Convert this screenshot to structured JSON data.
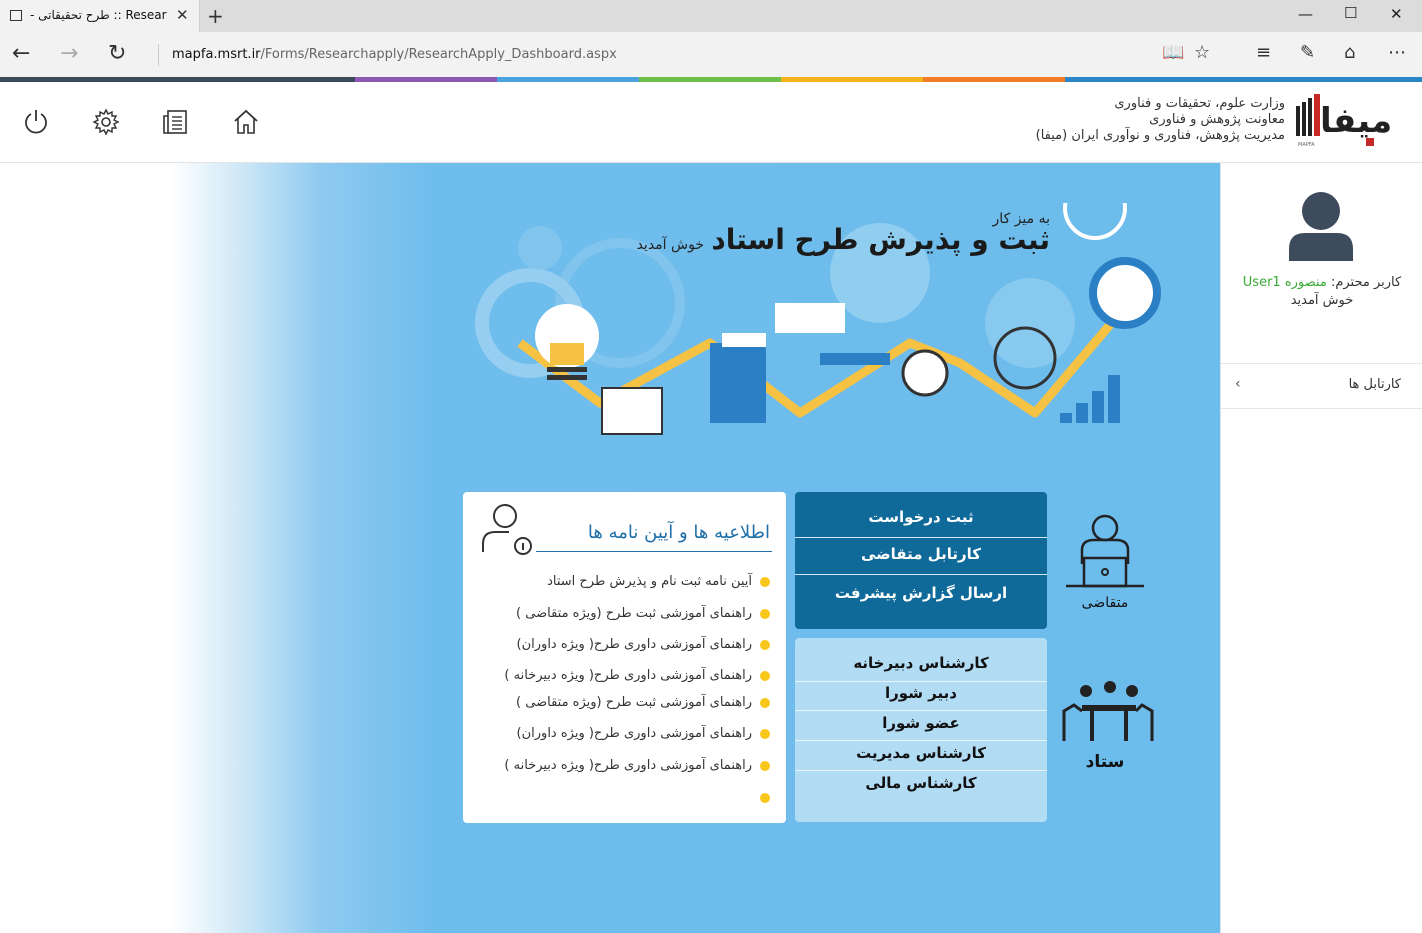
{
  "browser": {
    "tab_title": "Resear :: طرح تحقیقاتی -",
    "new_tab": "+",
    "url_domain": "mapfa.msrt.ir",
    "url_path": "/Forms/Researchapply/ResearchApply_Dashboard.aspx"
  },
  "header": {
    "org_line1": "وزارت علوم، تحقیقات و فناوری",
    "org_line2": "معاونت پژوهش و فناوری",
    "org_line3": "مدیریت پژوهش، فناوری و نوآوری ایران (میفا)",
    "logo_text": "میفا",
    "logo_sub": "MAPFA"
  },
  "sidebar": {
    "greeting_prefix": "کاربر محترم:",
    "username": "منصوره User1",
    "greeting_suffix": "خوش آمدید",
    "cartable_label": "کارتابل ها"
  },
  "hero": {
    "subtitle": "به میز کار",
    "title": "ثبت و پذیرش طرح استاد",
    "welcome": "خوش آمدید"
  },
  "notices": {
    "title": "اطلاعیه ها و آیین نامه ها",
    "items": [
      "آیین نامه ثبت نام و پذیرش طرح استاد",
      "راهنمای آموزشی ثبت طرح  (ویژه متقاضی )",
      "راهنمای آموزشی داوری طرح( ویژه داوران)",
      "راهنمای آموزشی داوری طرح( ویژه دبیرخانه )",
      "راهنمای آموزشی ثبت طرح  (ویژه متقاضی )",
      "راهنمای آموزشی داوری طرح( ویژه داوران)",
      "راهنمای آموزشی داوری طرح( ویژه دبیرخانه )"
    ]
  },
  "applicant": {
    "label": "متقاضی",
    "items": [
      "ثبت درخواست",
      "کارتابل متقاضی",
      "ارسال گزارش پیشرفت"
    ]
  },
  "staff": {
    "label": "ستاد",
    "items": [
      "کارشناس دبیرخانه",
      "دبیر شورا",
      "عضو شورا",
      "کارشناس مدیریت",
      "کارشناس مالی"
    ]
  },
  "colors": {
    "applicant_bg": "#0f6a99",
    "staff_bg": "#b2dbf4",
    "notice_title": "#1e6fa8",
    "bullet": "#f9c71a",
    "username": "#3aaa35"
  }
}
